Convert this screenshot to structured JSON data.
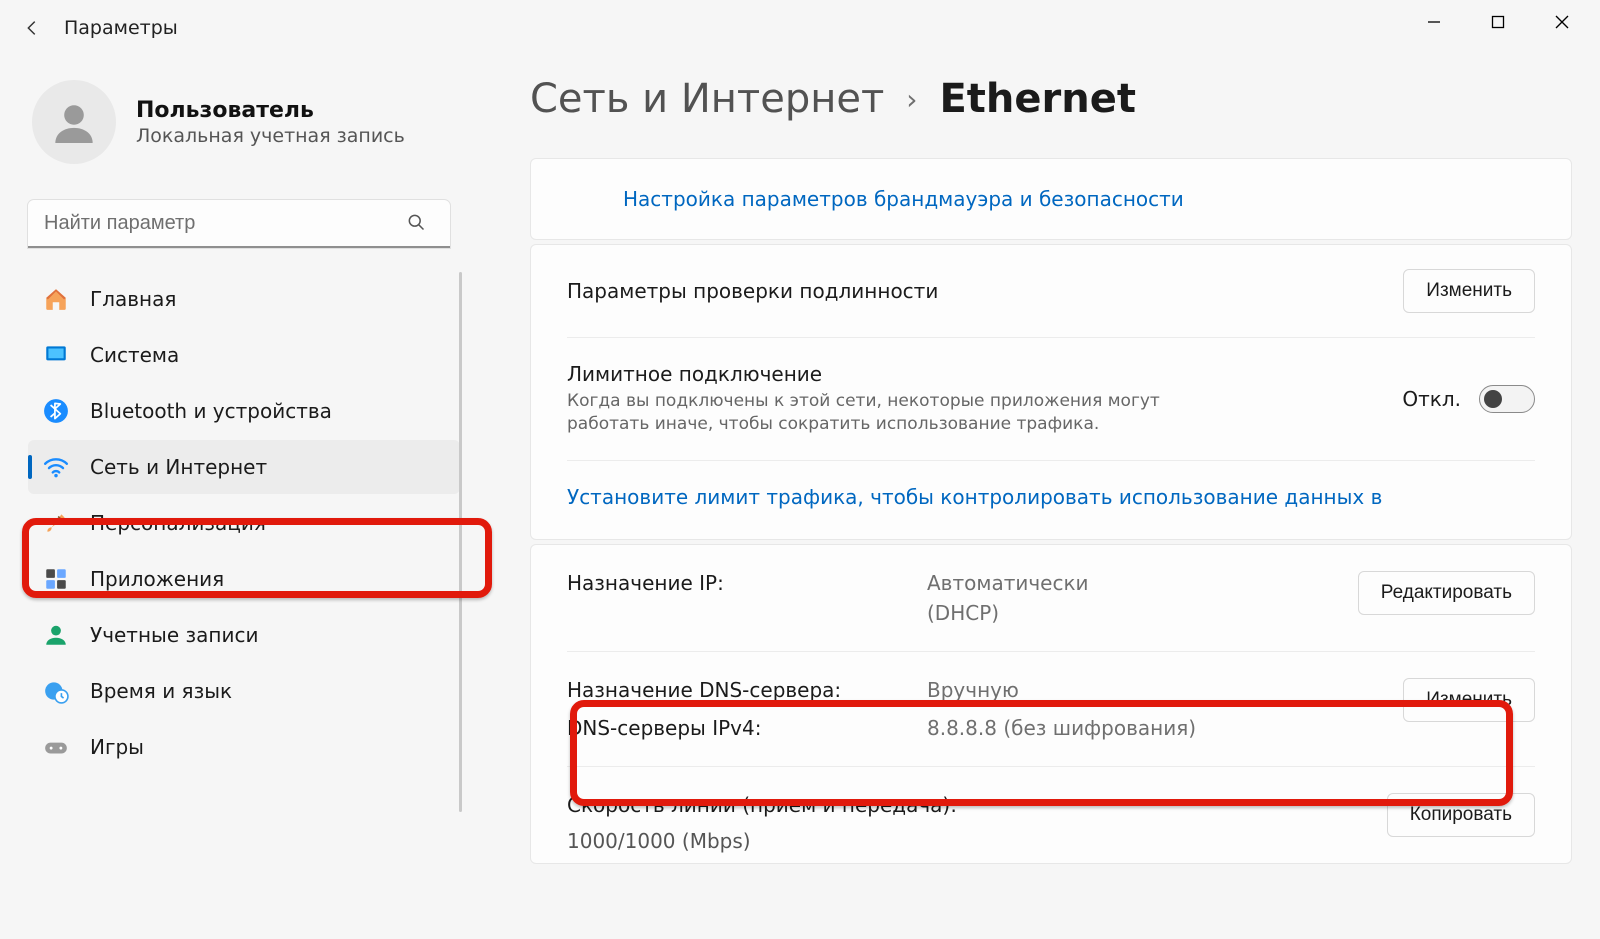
{
  "window": {
    "app_title": "Параметры"
  },
  "user": {
    "name": "Пользователь",
    "subtitle": "Локальная учетная запись"
  },
  "search": {
    "placeholder": "Найти параметр"
  },
  "nav": {
    "items": [
      {
        "label": "Главная"
      },
      {
        "label": "Система"
      },
      {
        "label": "Bluetooth и устройства"
      },
      {
        "label": "Сеть и Интернет"
      },
      {
        "label": "Персонализация"
      },
      {
        "label": "Приложения"
      },
      {
        "label": "Учетные записи"
      },
      {
        "label": "Время и язык"
      },
      {
        "label": "Игры"
      }
    ]
  },
  "breadcrumb": {
    "parent": "Сеть и Интернет",
    "current": "Ethernet"
  },
  "content": {
    "firewall_link": "Настройка параметров брандмауэра и безопасности",
    "auth_row": {
      "title": "Параметры проверки подлинности",
      "button": "Изменить"
    },
    "metered_row": {
      "title": "Лимитное подключение",
      "description": "Когда вы подключены к этой сети, некоторые приложения могут работать иначе, чтобы сократить использование трафика.",
      "toggle_state": "Откл."
    },
    "data_limit_link": "Установите лимит трафика, чтобы контролировать использование данных в",
    "ip_row": {
      "label": "Назначение IP:",
      "value_line1": "Автоматически",
      "value_line2": "(DHCP)",
      "button": "Редактировать"
    },
    "dns_row": {
      "label1": "Назначение DNS-сервера:",
      "label2": "DNS-серверы IPv4:",
      "value1": "Вручную",
      "value2": "8.8.8.8 (без шифрования)",
      "button": "Изменить"
    },
    "speed_row": {
      "title": "Скорость линии (прием и передача):",
      "value": "1000/1000 (Mbps)",
      "button": "Копировать"
    }
  }
}
